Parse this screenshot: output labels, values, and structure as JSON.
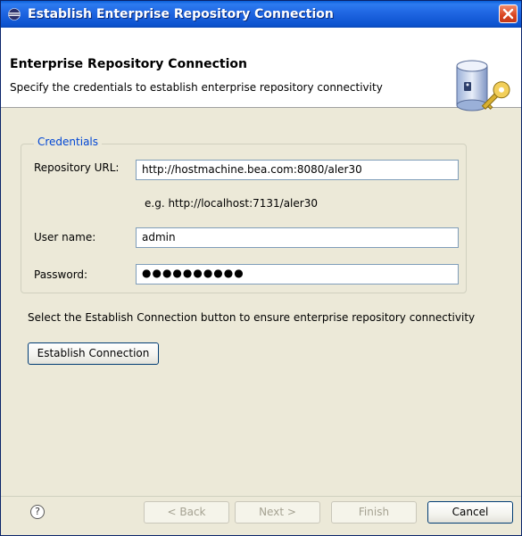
{
  "window": {
    "title": "Establish Enterprise Repository Connection"
  },
  "banner": {
    "heading": "Enterprise Repository Connection",
    "description": "Specify the credentials to establish enterprise repository connectivity"
  },
  "credentials": {
    "legend": "Credentials",
    "repository_url_label": "Repository URL:",
    "repository_url_value": "http://hostmachine.bea.com:8080/aler30",
    "url_example": "e.g. http://localhost:7131/aler30",
    "username_label": "User name:",
    "username_value": "admin",
    "password_label": "Password:",
    "password_mask": "●●●●●●●●●●"
  },
  "instruction": "Select the Establish Connection button to ensure enterprise repository connectivity",
  "establish_button": "Establish Connection",
  "footer": {
    "help_glyph": "?",
    "back": "< Back",
    "next": "Next >",
    "finish": "Finish",
    "cancel": "Cancel"
  },
  "colors": {
    "titlebar": "#1d63e0",
    "dialog_bg": "#ece9d8",
    "legend_text": "#0046d5",
    "close_button": "#d9441f"
  },
  "icons": {
    "app": "eclipse-icon",
    "close": "close-icon",
    "banner": "repository-key-icon",
    "help": "help-icon"
  }
}
